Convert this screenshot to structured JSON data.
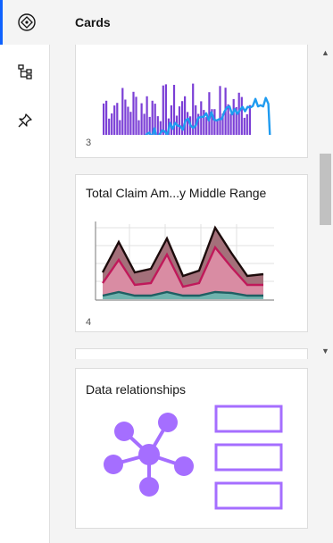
{
  "rail": {
    "items": [
      {
        "icon": "diamond-compass-icon",
        "active": true
      },
      {
        "icon": "hierarchy-icon",
        "active": false
      },
      {
        "icon": "pin-icon",
        "active": false
      }
    ]
  },
  "panel": {
    "title": "Cards"
  },
  "cards": [
    {
      "number": "3",
      "title": ""
    },
    {
      "number": "4",
      "title": "Total Claim Am...y Middle Range"
    },
    {
      "number": "",
      "title": ""
    }
  ],
  "relationships_card": {
    "title": "Data relationships"
  },
  "colors": {
    "accent": "#0f62fe",
    "bars": "#7b3fd6",
    "line": "#1f9bf0",
    "area_top": "#a4707a",
    "area_mid": "#d98ca3",
    "area_bottom": "#6fb3ae",
    "relationship": "#a56eff"
  }
}
